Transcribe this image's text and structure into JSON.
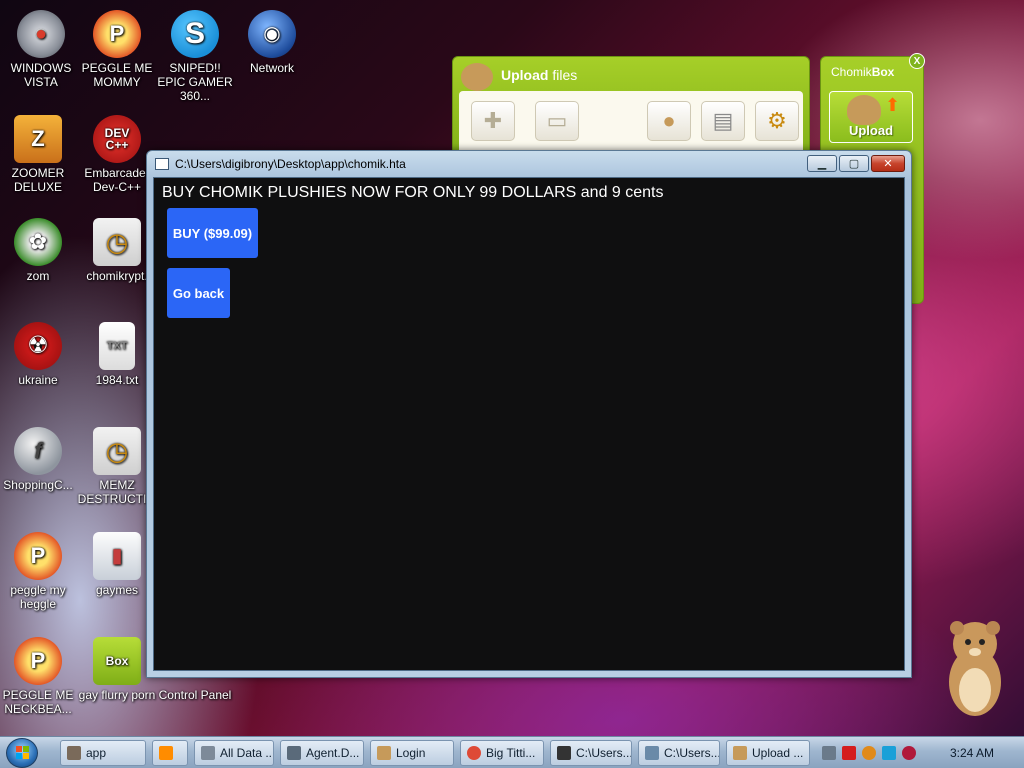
{
  "desktop_icons": [
    {
      "id": "windows-vista",
      "label": "WINDOWS VISTA",
      "color": "#d83b2b"
    },
    {
      "id": "peggle-me-mommy",
      "label": "PEGGLE ME MOMMY",
      "color": "#e0471f"
    },
    {
      "id": "sniped",
      "label": "SNIPED!! EPIC GAMER 360...",
      "color": "#1fa1e2"
    },
    {
      "id": "network",
      "label": "Network",
      "color": "#2a5fb8"
    },
    {
      "id": "zoomer-deluxe",
      "label": "ZOOMER DELUXE",
      "color": "#d88a1a"
    },
    {
      "id": "embarcadero",
      "label": "Embarcader Dev-C++",
      "color": "#c5171c"
    },
    {
      "id": "zom",
      "label": "zom",
      "color": "#3a8c2a"
    },
    {
      "id": "chomikrypt",
      "label": "chomikrypt.",
      "color": "#e4b229"
    },
    {
      "id": "ukraine",
      "label": "ukraine",
      "color": "#d61b1b"
    },
    {
      "id": "1984",
      "label": "1984.txt",
      "color": "#e6e6e6"
    },
    {
      "id": "shoppingc",
      "label": "ShoppingC...",
      "color": "#9aa3ad"
    },
    {
      "id": "memz",
      "label": "MEMZ DESTRUCTI...",
      "color": "#e4b229"
    },
    {
      "id": "peggle-my-heggle",
      "label": "peggle my heggle",
      "color": "#e0471f"
    },
    {
      "id": "gaymes",
      "label": "gaymes",
      "color": "#cfd6df"
    },
    {
      "id": "peggle-me-neckbea",
      "label": "PEGGLE ME NECKBEA...",
      "color": "#e0471f"
    },
    {
      "id": "gay-flurry-porn",
      "label": "gay flurry porn",
      "color": "#8fbf2b"
    },
    {
      "id": "control-panel",
      "label": "Control Panel",
      "color": "#5a7ea8"
    }
  ],
  "upload_panel": {
    "title_bold": "Upload",
    "title_rest": " files"
  },
  "chomikbox": {
    "title_regular": "Chomik",
    "title_bold": "Box",
    "close": "X",
    "upload_label": "Upload"
  },
  "hta_window": {
    "title": "C:\\Users\\digibrony\\Desktop\\app\\chomik.hta",
    "heading": "BUY CHOMIK PLUSHIES NOW FOR ONLY 99 DOLLARS and 9 cents",
    "buy_label": "BUY ($99.09)",
    "back_label": "Go back",
    "button_color": "#2b66f6",
    "background_color": "#0f0f10"
  },
  "taskbar": {
    "items": [
      {
        "label": "app",
        "color": "#7a6a5a"
      },
      {
        "label": "",
        "color": "#ff8c00"
      },
      {
        "label": "All Data ...",
        "color": "#7d8a99"
      },
      {
        "label": "Agent.D...",
        "color": "#5a6a7a"
      },
      {
        "label": "Login",
        "color": "#c69a5a"
      },
      {
        "label": "Big Titti...",
        "color": "#de4a37"
      },
      {
        "label": "C:\\Users...",
        "color": "#333333"
      },
      {
        "label": "C:\\Users...",
        "color": "#6a8aa8"
      },
      {
        "label": "Upload ...",
        "color": "#c69a5a"
      }
    ],
    "clock": "3:24 AM"
  }
}
